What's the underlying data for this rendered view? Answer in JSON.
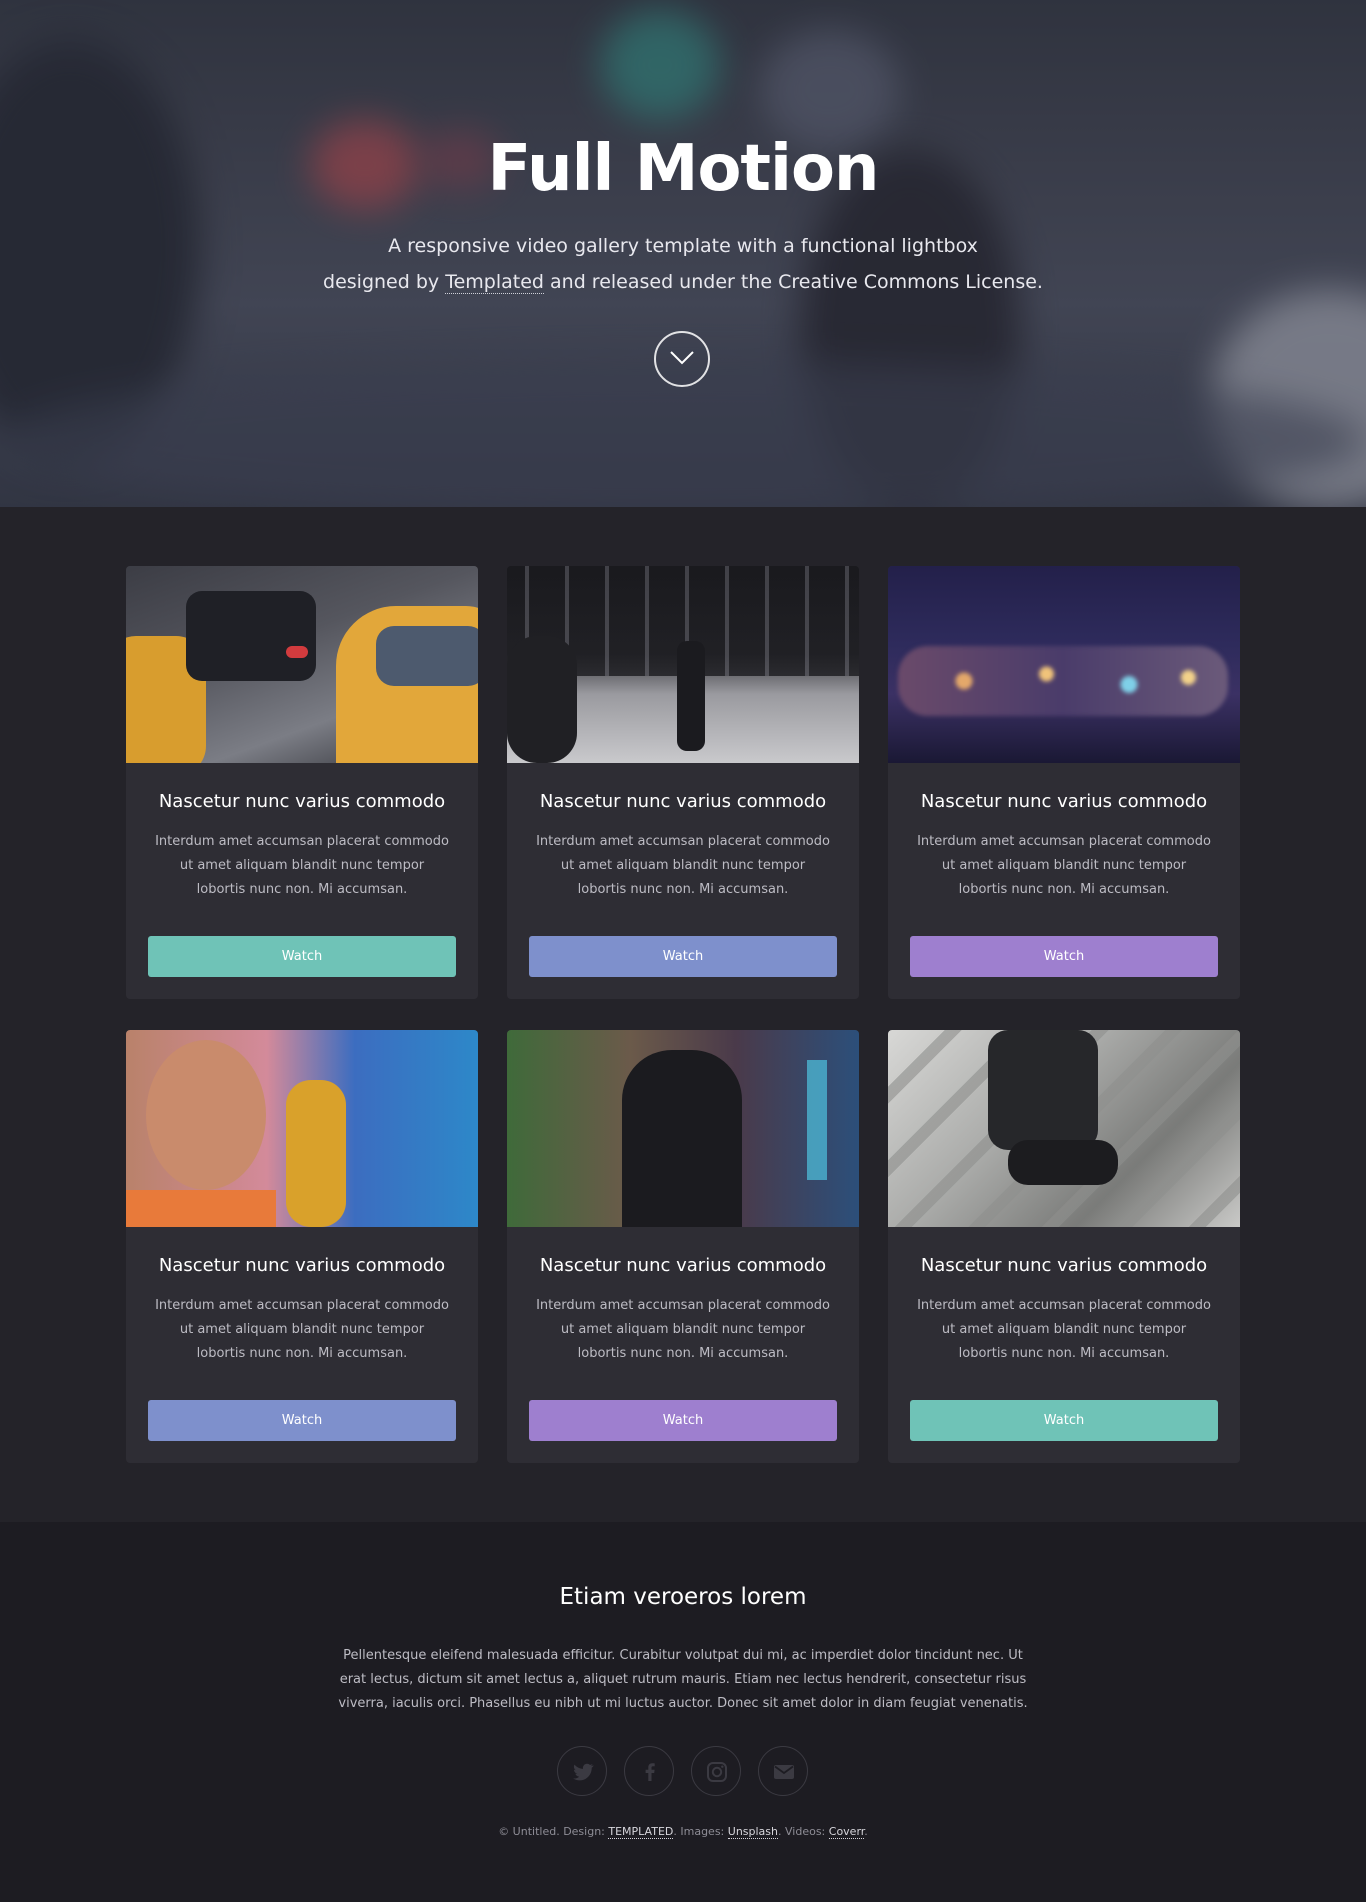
{
  "hero": {
    "title": "Full Motion",
    "line1": "A responsive video gallery template with a functional lightbox",
    "line2_before": "designed by",
    "line2_link": "Templated",
    "line2_after": "and released under the Creative Commons License.",
    "scroll_icon": "chevron-down-icon"
  },
  "cards": [
    {
      "title": "Nascetur nunc varius commodo",
      "text": "Interdum amet accumsan placerat commodo ut amet aliquam blandit nunc tempor lobortis nunc non. Mi accumsan.",
      "button": "Watch",
      "button_color": "#6fc3b7"
    },
    {
      "title": "Nascetur nunc varius commodo",
      "text": "Interdum amet accumsan placerat commodo ut amet aliquam blandit nunc tempor lobortis nunc non. Mi accumsan.",
      "button": "Watch",
      "button_color": "#7e90cc"
    },
    {
      "title": "Nascetur nunc varius commodo",
      "text": "Interdum amet accumsan placerat commodo ut amet aliquam blandit nunc tempor lobortis nunc non. Mi accumsan.",
      "button": "Watch",
      "button_color": "#9e7fcf"
    },
    {
      "title": "Nascetur nunc varius commodo",
      "text": "Interdum amet accumsan placerat commodo ut amet aliquam blandit nunc tempor lobortis nunc non. Mi accumsan.",
      "button": "Watch",
      "button_color": "#7e90cc"
    },
    {
      "title": "Nascetur nunc varius commodo",
      "text": "Interdum amet accumsan placerat commodo ut amet aliquam blandit nunc tempor lobortis nunc non. Mi accumsan.",
      "button": "Watch",
      "button_color": "#9e7fcf"
    },
    {
      "title": "Nascetur nunc varius commodo",
      "text": "Interdum amet accumsan placerat commodo ut amet aliquam blandit nunc tempor lobortis nunc non. Mi accumsan.",
      "button": "Watch",
      "button_color": "#6fc3b7"
    }
  ],
  "footer": {
    "heading": "Etiam veroeros lorem",
    "text": "Pellentesque eleifend malesuada efficitur. Curabitur volutpat dui mi, ac imperdiet dolor tincidunt nec. Ut erat lectus, dictum sit amet lectus a, aliquet rutrum mauris. Etiam nec lectus hendrerit, consectetur risus viverra, iaculis orci. Phasellus eu nibh ut mi luctus auctor. Donec sit amet dolor in diam feugiat venenatis.",
    "social_icons": [
      "twitter-icon",
      "facebook-icon",
      "instagram-icon",
      "email-icon"
    ],
    "copyright_prefix": "© Untitled. Design:",
    "design_link": "TEMPLATED",
    "images_label": ". Images:",
    "images_link": "Unsplash",
    "videos_label": ". Videos:",
    "videos_link": "Coverr",
    "end": "."
  },
  "colors": {
    "page_bg": "#242329",
    "card_bg": "#2e2d34",
    "footer_bg": "#1d1c22",
    "teal": "#6fc3b7",
    "blue": "#7e90cc",
    "purple": "#9e7fcf"
  }
}
